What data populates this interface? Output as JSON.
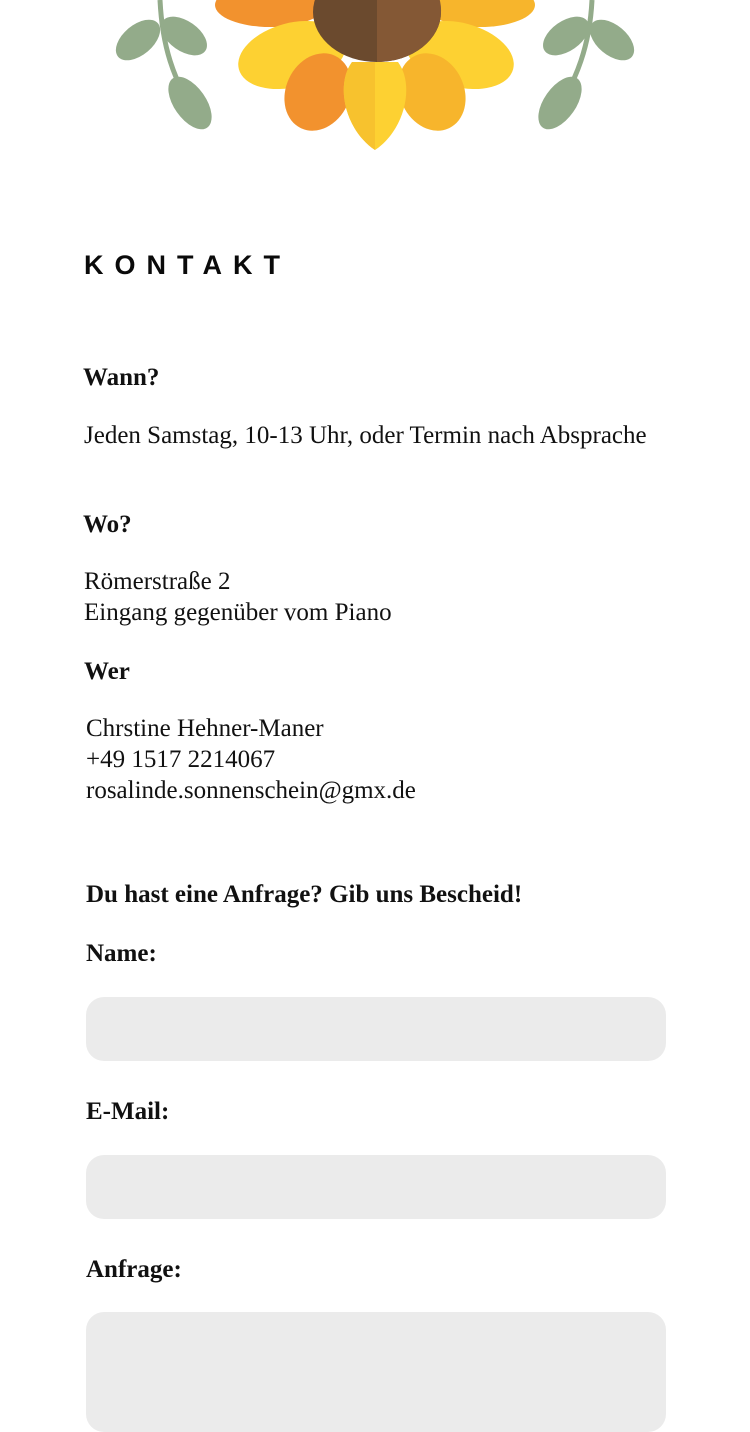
{
  "colors": {
    "background": "#ffffff",
    "text": "#111111",
    "field": "#ebebeb",
    "petal_orange": "#f2922e",
    "petal_yellow": "#fdd132",
    "petal_gold": "#f7b52c",
    "flower_center": "#6b4a2e",
    "leaf_green": "#93ab8a"
  },
  "hero": {
    "image": "sunflower-illustration"
  },
  "contact": {
    "heading": "KONTAKT",
    "when": {
      "label": "Wann?",
      "lines": [
        "Jeden Samstag, 10-13 Uhr, oder Termin nach Absprache"
      ]
    },
    "where": {
      "label": "Wo?",
      "lines": [
        "Römerstraße 2",
        "Eingang gegenüber vom Piano"
      ]
    },
    "who": {
      "label": "Wer",
      "lines": [
        "Chrstine Hehner-Maner",
        "+49 1517 2214067",
        "rosalinde.sonnenschein@gmx.de"
      ]
    }
  },
  "form": {
    "intro": "Du hast eine Anfrage? Gib uns Bescheid!",
    "name_label": "Name:",
    "name_value": "",
    "email_label": "E-Mail:",
    "email_value": "",
    "request_label": "Anfrage:",
    "request_value": ""
  }
}
